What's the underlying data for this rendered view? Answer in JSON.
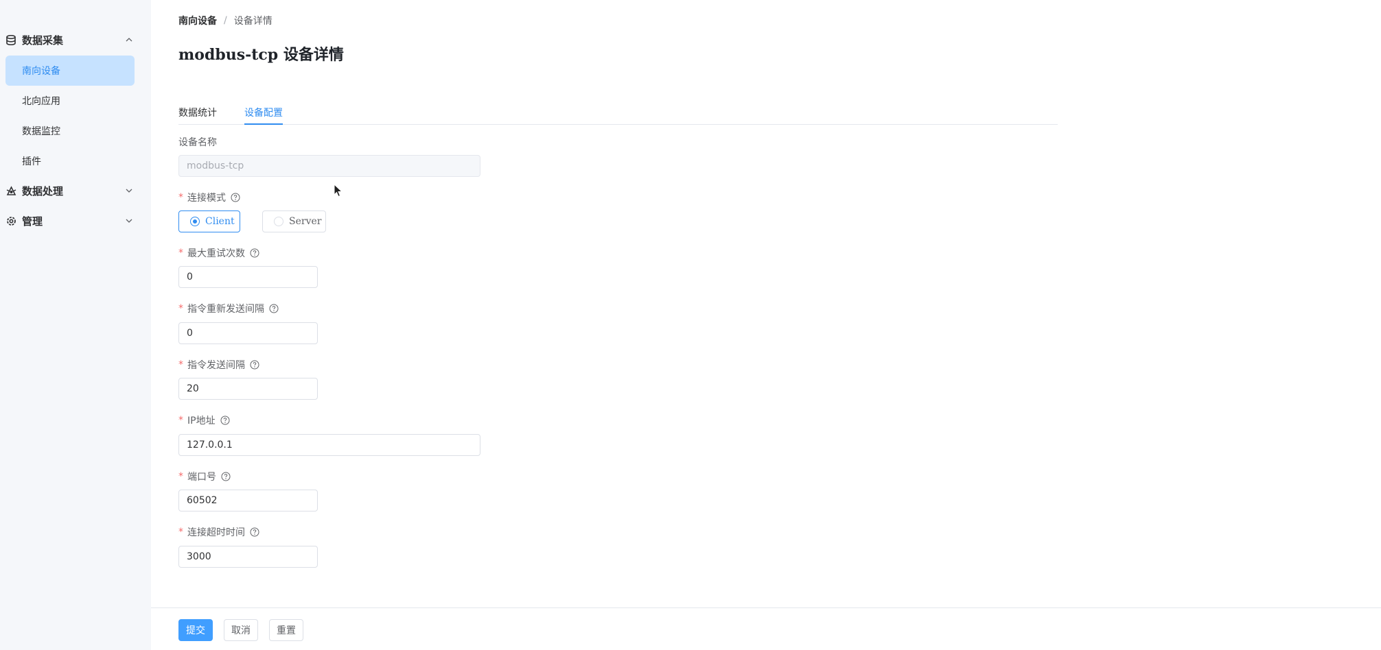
{
  "sidebar": {
    "groups": [
      {
        "label": "数据采集",
        "icon": "database-icon",
        "expanded": true
      },
      {
        "label": "数据处理",
        "icon": "process-icon",
        "expanded": false
      },
      {
        "label": "管理",
        "icon": "gear-icon",
        "expanded": false
      }
    ],
    "items": [
      {
        "label": "南向设备",
        "active": true
      },
      {
        "label": "北向应用",
        "active": false
      },
      {
        "label": "数据监控",
        "active": false
      },
      {
        "label": "插件",
        "active": false
      }
    ]
  },
  "breadcrumb": {
    "parent": "南向设备",
    "separator": "/",
    "current": "设备详情"
  },
  "page": {
    "title": "modbus-tcp 设备详情"
  },
  "tabs": [
    {
      "label": "数据统计",
      "active": false
    },
    {
      "label": "设备配置",
      "active": true
    }
  ],
  "form": {
    "name": {
      "label": "设备名称",
      "value": "modbus-tcp"
    },
    "mode": {
      "label": "连接模式",
      "options": [
        {
          "label": "Client",
          "checked": true
        },
        {
          "label": "Server",
          "checked": false
        }
      ]
    },
    "max_retry": {
      "label": "最大重试次数",
      "value": "0"
    },
    "resend_interval": {
      "label": "指令重新发送间隔",
      "value": "0"
    },
    "send_interval": {
      "label": "指令发送间隔",
      "value": "20"
    },
    "ip": {
      "label": "IP地址",
      "value": "127.0.0.1"
    },
    "port": {
      "label": "端口号",
      "value": "60502"
    },
    "timeout": {
      "label": "连接超时时间",
      "value": "3000"
    },
    "required_mark": "*"
  },
  "footer": {
    "submit": "提交",
    "cancel": "取消",
    "reset": "重置"
  },
  "colors": {
    "accent": "#409eff",
    "active_bg": "#c6e2ff",
    "required": "#f56c6c"
  }
}
